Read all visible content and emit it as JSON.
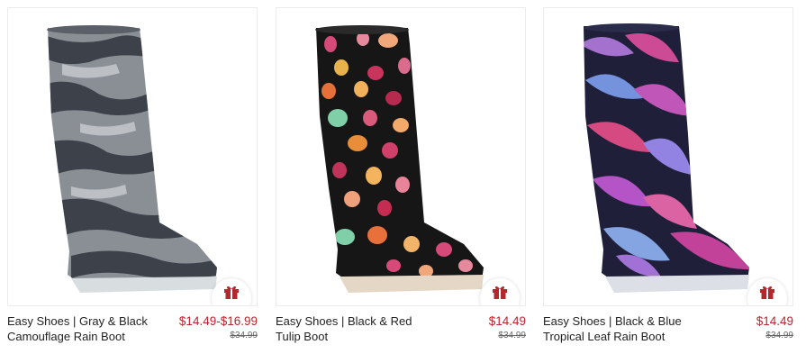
{
  "products": [
    {
      "name_line1": "Easy Shoes | Gray & Black",
      "name_line2": "Camouflage Rain Boot",
      "price": "$14.49-$16.99",
      "original_price": "$34.99",
      "image_icon": "gray-camouflage-rain-boot-image"
    },
    {
      "name_line1": "Easy Shoes | Black & Red",
      "name_line2": "Tulip Boot",
      "price": "$14.49",
      "original_price": "$34.99",
      "image_icon": "black-red-tulip-boot-image"
    },
    {
      "name_line1": "Easy Shoes | Black & Blue",
      "name_line2": "Tropical Leaf Rain Boot",
      "price": "$14.49",
      "original_price": "$34.99",
      "image_icon": "black-blue-tropical-leaf-boot-image"
    }
  ],
  "colors": {
    "price": "#b3282d",
    "gift_icon": "#b3282d",
    "text": "#222222"
  },
  "icons": {
    "gift": "gift-icon"
  }
}
